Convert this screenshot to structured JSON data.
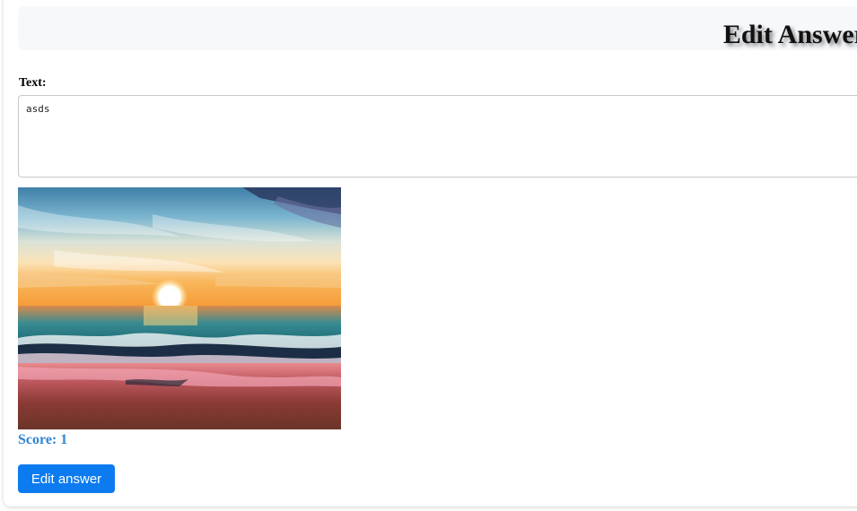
{
  "header": {
    "title": "Edit Answer"
  },
  "form": {
    "text_label": "Text:",
    "text_value": "asds"
  },
  "answer": {
    "image_icon": "sunset-beach-painting",
    "score_text": "Score: 1"
  },
  "actions": {
    "edit_label": "Edit answer"
  },
  "colors": {
    "accent": "#0d7bf0",
    "score": "#2f86d6",
    "header_bg": "#f7f8fa"
  }
}
